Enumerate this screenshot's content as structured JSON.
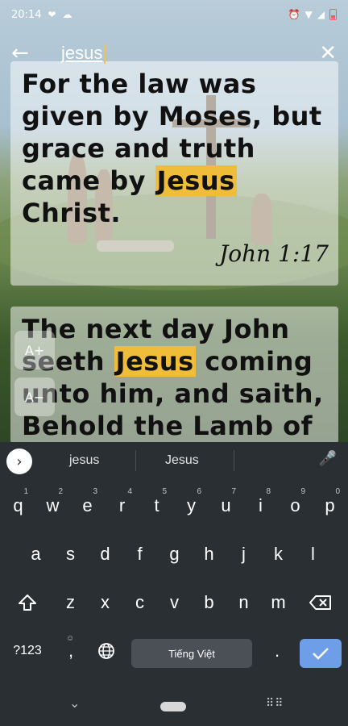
{
  "status": {
    "time": "20:14",
    "icons": [
      "heart-chat-icon",
      "cloud-icon",
      "alarm-icon",
      "wifi-icon",
      "signal-icon",
      "battery-low-icon"
    ]
  },
  "search": {
    "query": "jesus",
    "back_icon": "arrow-left-icon",
    "close_icon": "close-icon"
  },
  "results": [
    {
      "before": "For the law was given by Moses, but grace and truth came by ",
      "highlight": "Jesus",
      "after": " Christ.",
      "reference": "John 1:17"
    },
    {
      "before": "The next day John seeth ",
      "highlight": "Jesus",
      "after": " coming unto him, and saith, Behold the Lamb of"
    }
  ],
  "font_controls": {
    "increase_label": "A+",
    "decrease_label": "A−"
  },
  "colors": {
    "highlight": "#efbd3a",
    "keyboard_bg": "#2a2f33",
    "enter_key": "#6f9ee8"
  },
  "keyboard": {
    "suggestions": [
      "jesus",
      "Jesus"
    ],
    "row1": [
      {
        "k": "q",
        "h": "1"
      },
      {
        "k": "w",
        "h": "2"
      },
      {
        "k": "e",
        "h": "3"
      },
      {
        "k": "r",
        "h": "4"
      },
      {
        "k": "t",
        "h": "5"
      },
      {
        "k": "y",
        "h": "6"
      },
      {
        "k": "u",
        "h": "7"
      },
      {
        "k": "i",
        "h": "8"
      },
      {
        "k": "o",
        "h": "9"
      },
      {
        "k": "p",
        "h": "0"
      }
    ],
    "row2": [
      "a",
      "s",
      "d",
      "f",
      "g",
      "h",
      "j",
      "k",
      "l"
    ],
    "row3": [
      "z",
      "x",
      "c",
      "v",
      "b",
      "n",
      "m"
    ],
    "numbers_label": "?123",
    "comma_label": ",",
    "space_label": "Tiếng Việt",
    "period_label": "."
  }
}
